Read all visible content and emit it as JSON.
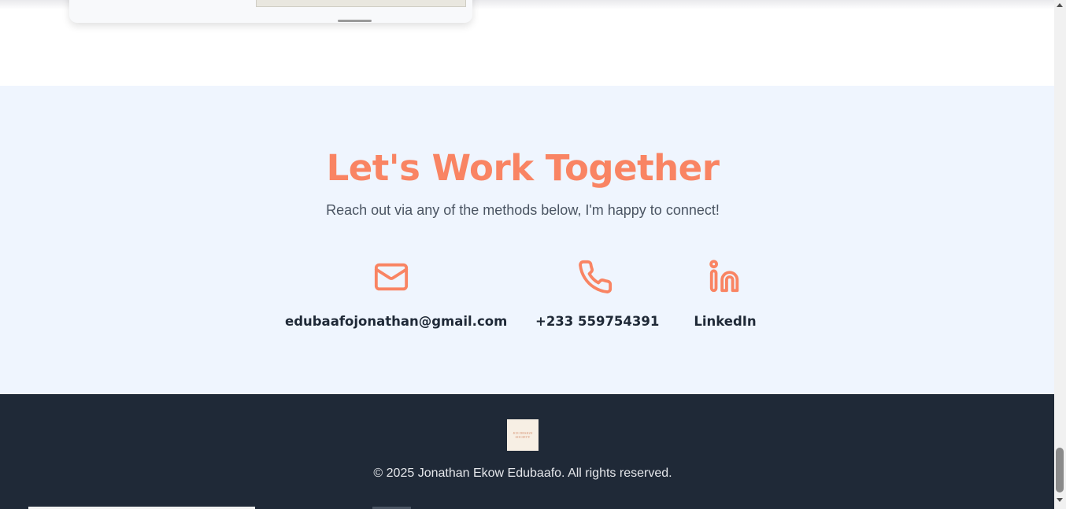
{
  "contact": {
    "title": "Let's Work Together",
    "subtitle": "Reach out via any of the methods below, I'm happy to connect!",
    "methods": [
      {
        "icon": "mail-icon",
        "label": "edubaafojonathan@gmail.com"
      },
      {
        "icon": "phone-icon",
        "label": "+233 559754391"
      },
      {
        "icon": "linkedin-icon",
        "label": "LinkedIn"
      }
    ]
  },
  "footer": {
    "logo_text": "JCE DESIGN SOCIETY",
    "copyright": "© 2025 Jonathan Ekow Edubaafo. All rights reserved."
  },
  "colors": {
    "accent": "#f98463",
    "contact_bg": "#eff5fe",
    "footer_bg": "#1f2937",
    "text_dark": "#1f2937",
    "text_muted": "#4b5563"
  }
}
